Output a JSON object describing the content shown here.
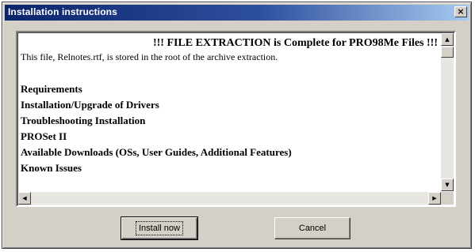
{
  "window": {
    "title": "Installation instructions",
    "close_glyph": "×"
  },
  "document": {
    "heading": "!!! FILE EXTRACTION is Complete for PRO98Me Files !!!",
    "intro": "This file, Relnotes.rtf, is stored in the root of the archive extraction.",
    "links": [
      "Requirements",
      "Installation/Upgrade of Drivers",
      "Troubleshooting Installation",
      "PROSet II",
      "Available Downloads (OSs, User Guides, Additional Features)",
      "Known Issues"
    ]
  },
  "scrollbars": {
    "up_glyph": "▲",
    "down_glyph": "▼",
    "left_glyph": "◀",
    "right_glyph": "▶"
  },
  "buttons": {
    "install_now": "Install now",
    "cancel": "Cancel"
  },
  "colors": {
    "title_start": "#0a246a",
    "title_end": "#a6caf0",
    "face": "#d4d0c8"
  },
  "icons": [
    "close-icon",
    "scroll-up-icon",
    "scroll-down-icon",
    "scroll-left-icon",
    "scroll-right-icon"
  ]
}
